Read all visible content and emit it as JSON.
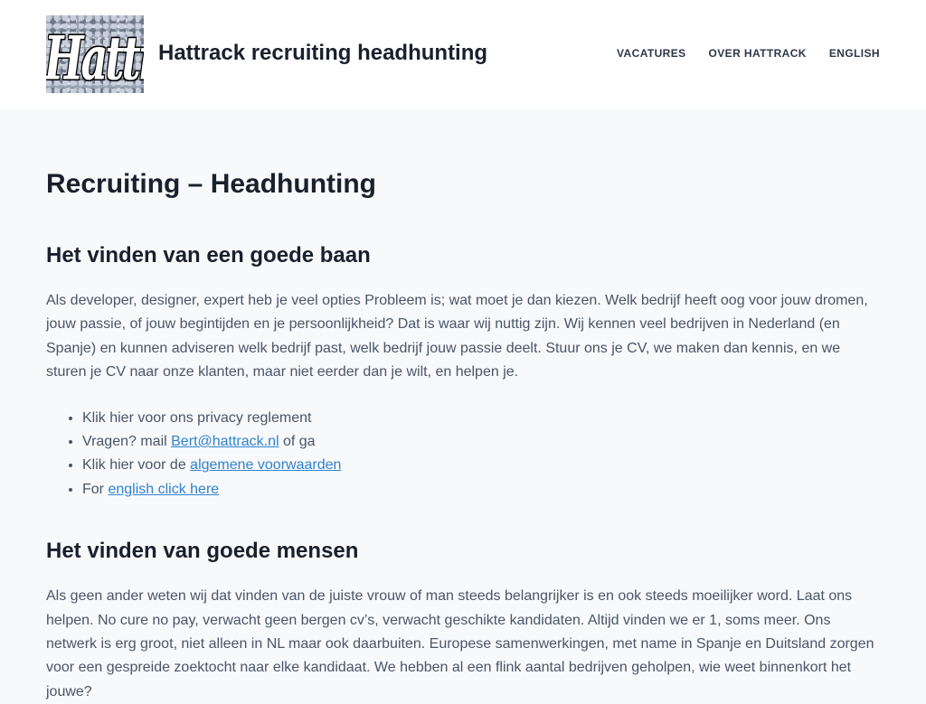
{
  "header": {
    "logo_text": "Hattrack",
    "site_title": "Hattrack recruiting headhunting",
    "nav": [
      {
        "label": "VACATURES"
      },
      {
        "label": "OVER HATTRACK"
      },
      {
        "label": "ENGLISH"
      }
    ]
  },
  "main": {
    "page_title": "Recruiting – Headhunting",
    "section1": {
      "heading": "Het vinden van een goede baan",
      "paragraph": "Als developer, designer, expert heb je veel opties  Probleem is; wat moet je dan kiezen. Welk bedrijf heeft oog voor jouw dromen, jouw passie, of jouw begintijden en je persoonlijkheid? Dat is waar wij nuttig zijn. Wij kennen veel bedrijven in Nederland (en Spanje) en kunnen adviseren welk bedrijf past, welk bedrijf jouw passie deelt. Stuur ons je CV, we maken dan kennis, en we sturen je CV naar onze klanten, maar niet  eerder dan je wilt, en helpen je.",
      "list": {
        "item1": "Klik hier voor ons privacy reglement",
        "item2_prefix": "Vragen? mail ",
        "item2_link": "Bert@hattrack.nl",
        "item2_suffix": " of ga",
        "item3_prefix": "Klik hier voor de ",
        "item3_link": "algemene voorwaarden",
        "item4_prefix": "For ",
        "item4_link": "english click here"
      }
    },
    "section2": {
      "heading": "Het vinden van goede mensen",
      "paragraph": "Als geen ander weten wij dat vinden van de juiste vrouw of man steeds belangrijker is en ook steeds moeilijker word. Laat ons helpen. No cure no pay, verwacht geen bergen cv’s, verwacht geschikte kandidaten. Altijd vinden we er 1, soms meer. Ons netwerk is erg groot, niet alleen in NL maar ook daarbuiten. Europese samenwerkingen, met name in Spanje en Duitsland zorgen voor een gespreide zoektocht naar elke kandidaat. We hebben al een flink aantal bedrijven geholpen, wie weet binnenkort het jouwe?"
    }
  },
  "colors": {
    "link": "#3182ce",
    "heading": "#1a202c",
    "body_text": "#4a5568",
    "background": "#f7f9fb"
  }
}
